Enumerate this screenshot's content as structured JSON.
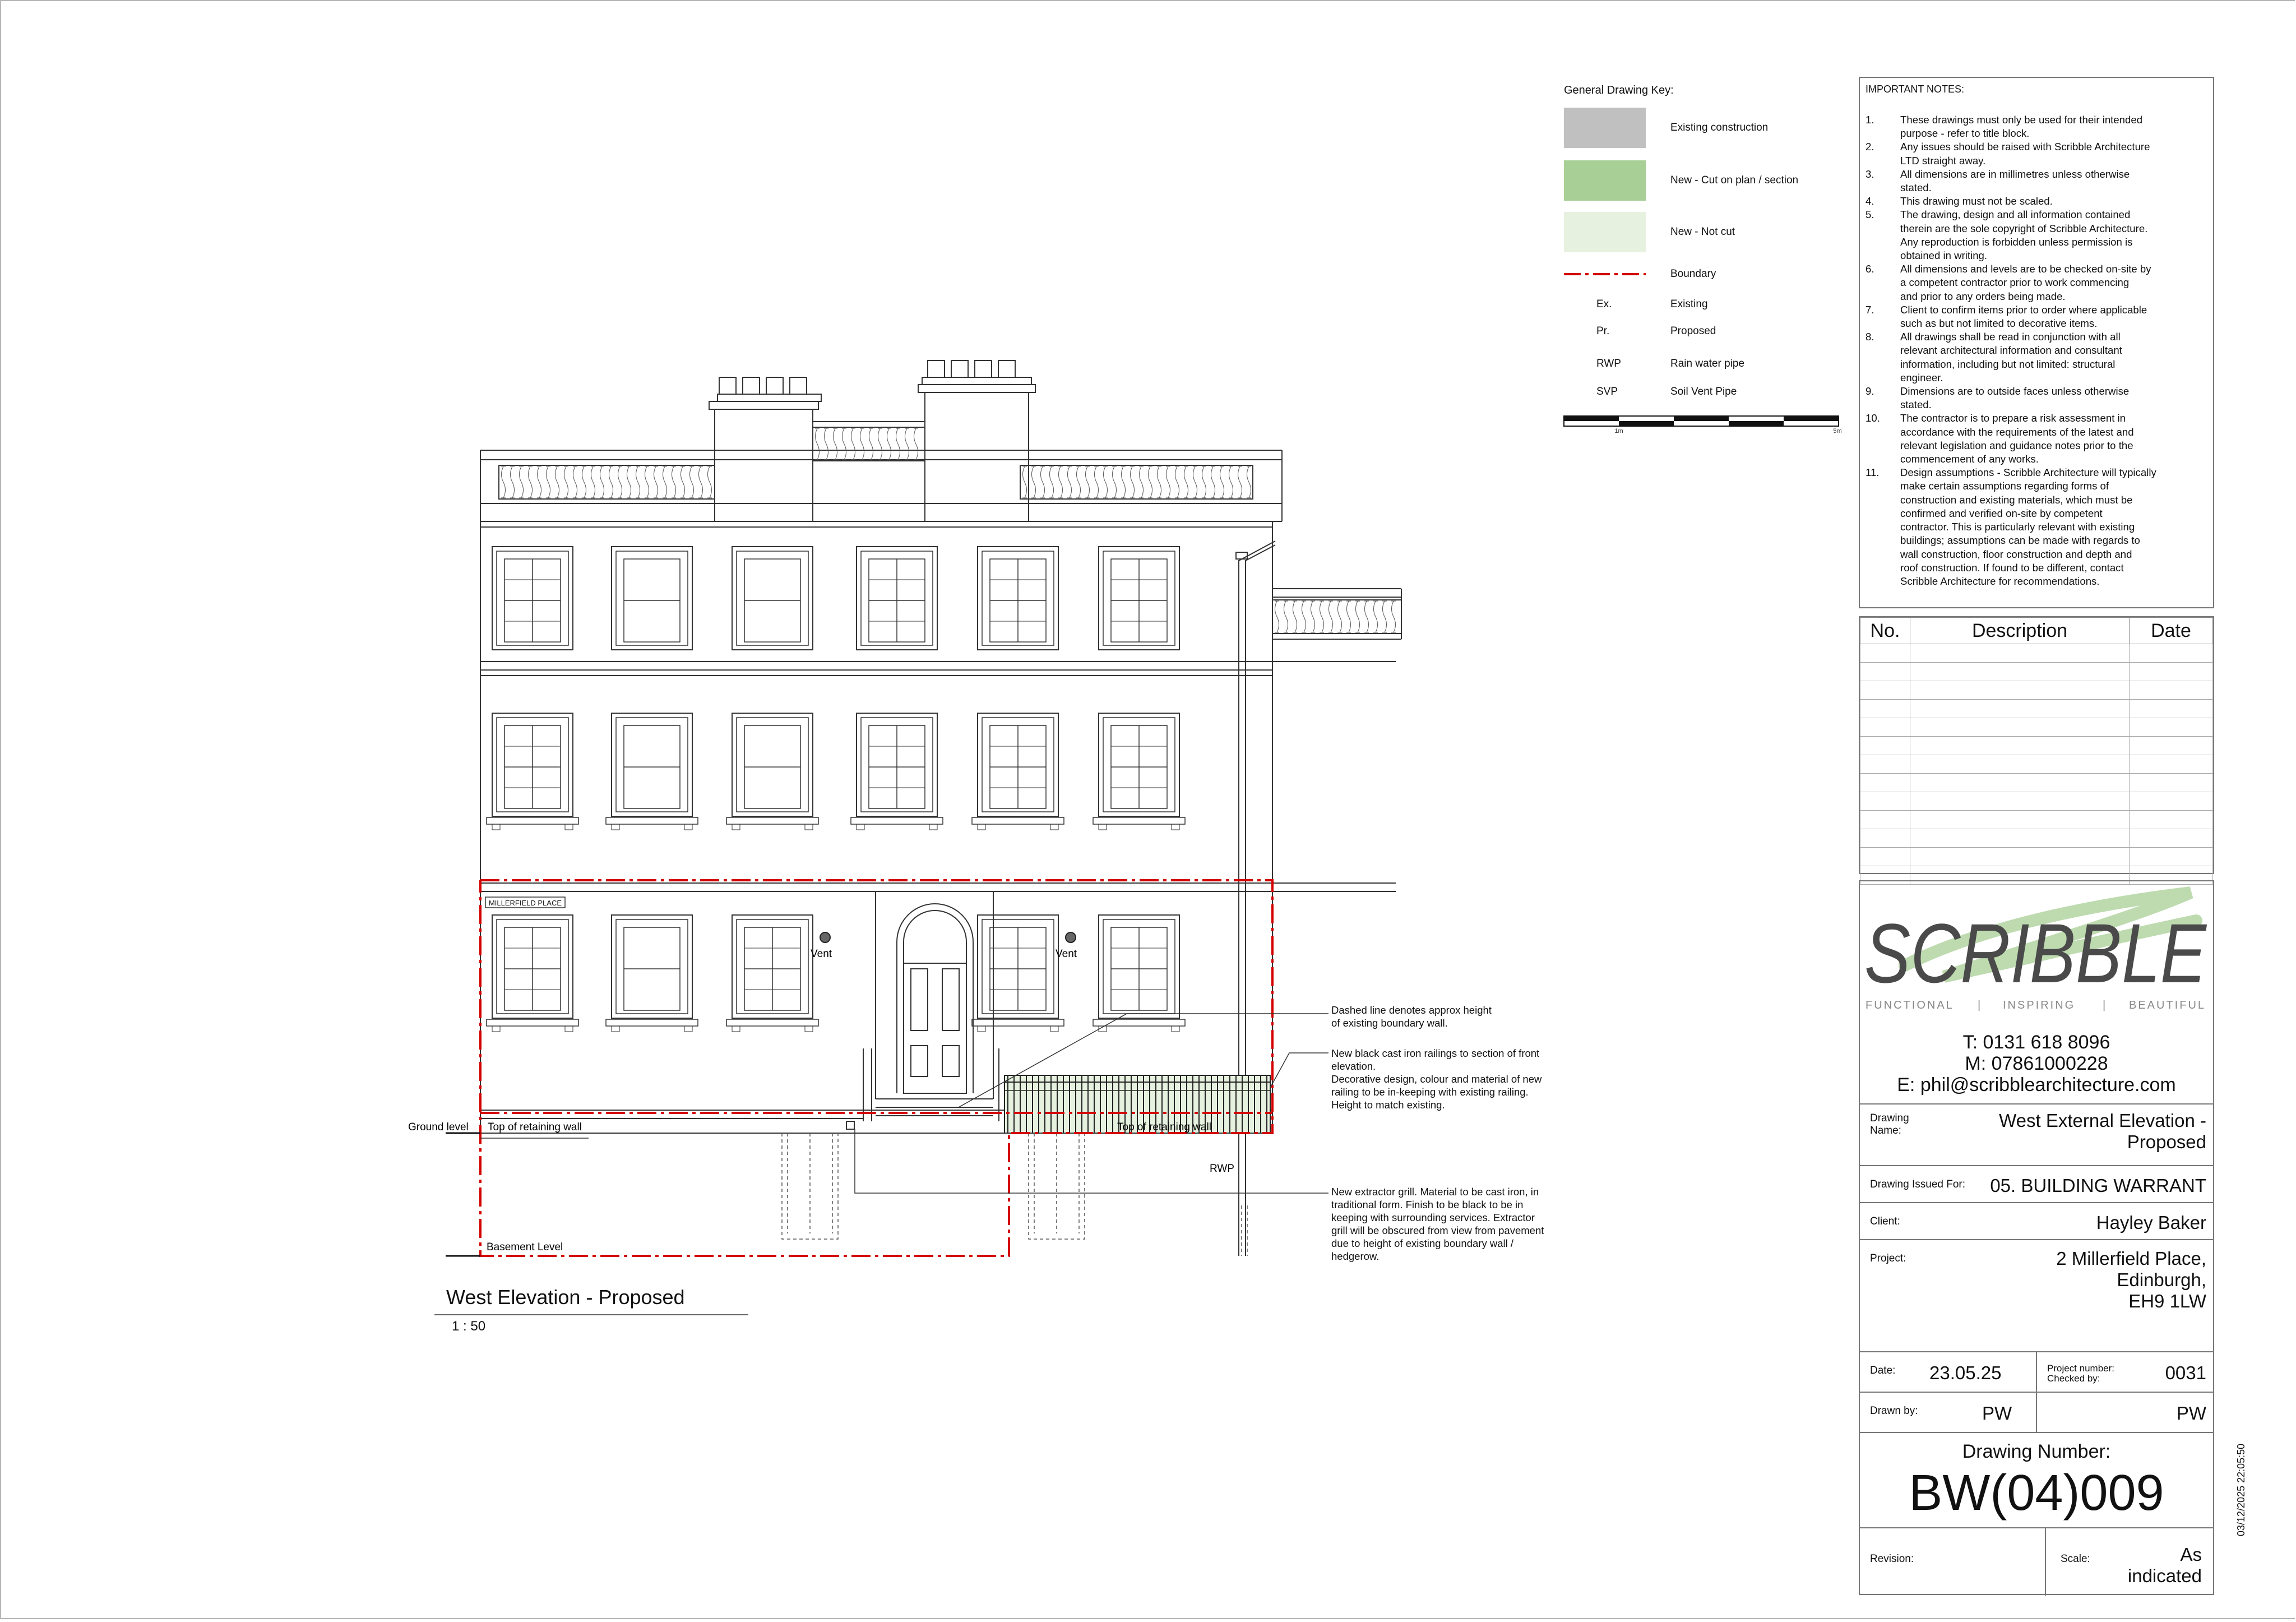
{
  "key": {
    "title": "General Drawing Key:",
    "items": [
      {
        "label": "Existing construction",
        "color": "#c0c0c0"
      },
      {
        "label": "New - Cut on plan / section",
        "color": "#a8cf96"
      },
      {
        "label": "New - Not cut",
        "color": "#e6f2df"
      },
      {
        "label": "Boundary",
        "color": "#d40000"
      }
    ],
    "abbreviations": [
      {
        "abbr": "Ex.",
        "desc": "Existing"
      },
      {
        "abbr": "Pr.",
        "desc": "Proposed"
      },
      {
        "abbr": "RWP",
        "desc": "Rain water pipe"
      },
      {
        "abbr": "SVP",
        "desc": "Soil Vent Pipe"
      }
    ],
    "scale_bar": {
      "left": "1m",
      "right": "5m"
    }
  },
  "notes": {
    "title": "IMPORTANT NOTES:",
    "items": [
      {
        "num": "1.",
        "lines": [
          "These drawings must only be used for their intended",
          "purpose - refer to title block."
        ]
      },
      {
        "num": "2.",
        "lines": [
          "Any issues should be raised with Scribble Architecture",
          "LTD straight away."
        ]
      },
      {
        "num": "3.",
        "lines": [
          "All dimensions are in millimetres unless otherwise",
          "stated."
        ]
      },
      {
        "num": "4.",
        "lines": [
          "This drawing must not be scaled."
        ]
      },
      {
        "num": "5.",
        "lines": [
          "The drawing, design and all information contained",
          "therein are the sole copyright of Scribble Architecture.",
          "Any reproduction is forbidden unless permission is",
          "obtained in writing."
        ]
      },
      {
        "num": "6.",
        "lines": [
          "All dimensions and levels are to be checked on-site by",
          "a competent contractor prior to work commencing",
          "and prior to any orders being made."
        ]
      },
      {
        "num": "7.",
        "lines": [
          "Client to confirm items prior to order where applicable",
          "such as but not limited to decorative items."
        ]
      },
      {
        "num": "8.",
        "lines": [
          "All drawings shall be read in conjunction with all",
          "relevant architectural information and consultant",
          "information, including but not limited: structural",
          "engineer."
        ]
      },
      {
        "num": "9.",
        "lines": [
          "Dimensions are to outside faces unless otherwise",
          "stated."
        ]
      },
      {
        "num": "10.",
        "lines": [
          "The contractor is to prepare a risk assessment in",
          "accordance with the requirements of the latest and",
          "relevant legislation and guidance notes prior to the",
          "commencement of any works."
        ]
      },
      {
        "num": "11.",
        "lines": [
          "Design assumptions - Scribble Architecture will typically",
          "make certain assumptions regarding forms of",
          "construction and existing materials, which must be",
          "confirmed and verified on-site by competent",
          "contractor. This is particularly relevant with existing",
          "buildings; assumptions can be made with regards to",
          "wall construction, floor construction and depth and",
          "roof construction. If found to be different, contact",
          "Scribble Architecture for recommendations."
        ]
      }
    ]
  },
  "revisions": {
    "headers": [
      "No.",
      "Description",
      "Date"
    ]
  },
  "title_block": {
    "logo": "SCRIBBLE",
    "tagline": [
      "FUNCTIONAL",
      "|",
      "INSPIRING",
      "|",
      "BEAUTIFUL"
    ],
    "phone": "T: 0131 618 8096",
    "mobile": "M: 07861000228",
    "email": "E: phil@scribblearchitecture.com",
    "drawing_name_label": "Drawing Name:",
    "drawing_name": [
      "West External Elevation -",
      "Proposed"
    ],
    "issued_for_label": "Drawing Issued For:",
    "issued_for": "05. BUILDING WARRANT",
    "client_label": "Client:",
    "client": "Hayley Baker",
    "project_label": "Project:",
    "project": [
      "2 Millerfield Place,",
      "Edinburgh,",
      "EH9 1LW"
    ],
    "date_label": "Date:",
    "date": "23.05.25",
    "project_number_label": "Project number:",
    "checked_by_label": "Checked by:",
    "project_number": "0031",
    "drawn_by_label": "Drawn by:",
    "drawn_by": "PW",
    "checked_by": "PW",
    "drawing_number_label": "Drawing Number:",
    "drawing_number": "BW(04)009",
    "revision_label": "Revision:",
    "scale_label": "Scale:",
    "scale": [
      "As",
      "indicated"
    ]
  },
  "timestamp": "03/12/2025 22:05:50",
  "drawing": {
    "title": "West Elevation - Proposed",
    "scale": "1 : 50",
    "street_sign": "MILLERFIELD PLACE",
    "labels": {
      "ground_level": "Ground level",
      "top_retaining_left": "Top of retaining wall",
      "top_retaining_right": "Top of retaining wall",
      "basement": "Basement Level",
      "rwp": "RWP",
      "vent_left": "Vent",
      "vent_right": "Vent"
    },
    "annotations": {
      "dashed": [
        "Dashed line denotes approx height",
        "of existing boundary wall."
      ],
      "railings": [
        "New black cast iron railings to section of front",
        "elevation.",
        "Decorative design, colour and material of new",
        "railing to be in-keeping with existing railing.",
        "Height to match existing."
      ],
      "grill": [
        "New extractor grill. Material to be cast iron, in",
        "traditional form. Finish to be black to be in",
        "keeping with surrounding services. Extractor",
        "grill will be obscured from view from pavement",
        "due to height of existing boundary wall /",
        "hedgerow."
      ]
    }
  }
}
